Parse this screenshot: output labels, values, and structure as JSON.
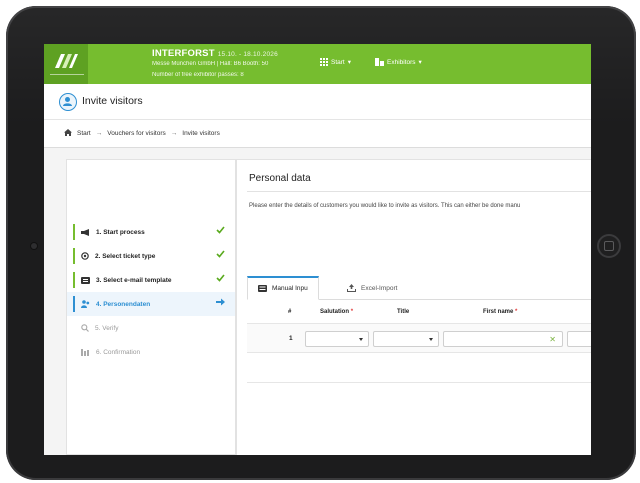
{
  "header": {
    "event_name": "INTERFORST",
    "event_dates": "15.10. - 18.10.2026",
    "company_line": "Messe München GmbH | Hall: B6 Booth: 50",
    "passes_line": "Number of free exhibitor passes: 8",
    "nav": [
      {
        "label": "Start",
        "icon": "grid-icon"
      },
      {
        "label": "Exhibitors",
        "icon": "exhibitors-icon"
      }
    ],
    "accent_color": "#76bd2f"
  },
  "page": {
    "title": "Invite visitors",
    "title_icon": "user-circle-icon"
  },
  "breadcrumb": {
    "items": [
      "Start",
      "Vouchers for visitors",
      "Invite visitors"
    ],
    "separator": "→"
  },
  "steps": [
    {
      "label": "1. Start process",
      "state": "done"
    },
    {
      "label": "2. Select ticket type",
      "state": "done"
    },
    {
      "label": "3. Select e-mail template",
      "state": "done"
    },
    {
      "label": "4. Personendaten",
      "state": "active"
    },
    {
      "label": "5. Verify",
      "state": "pending"
    },
    {
      "label": "6. Confirmation",
      "state": "pending"
    }
  ],
  "content": {
    "section_title": "Personal data",
    "description": "Please enter the details of customers you would like to invite as visitors. This can either be done manu",
    "tabs": [
      {
        "label": "Manual Inpu",
        "active": true
      },
      {
        "label": "Excel-Import",
        "active": false
      }
    ],
    "table": {
      "headers": [
        "#",
        "Salutation",
        "Title",
        "First name"
      ],
      "required_marker": "*",
      "rows": [
        {
          "num": "1",
          "salutation": "",
          "title": "",
          "first_name": ""
        }
      ]
    }
  }
}
